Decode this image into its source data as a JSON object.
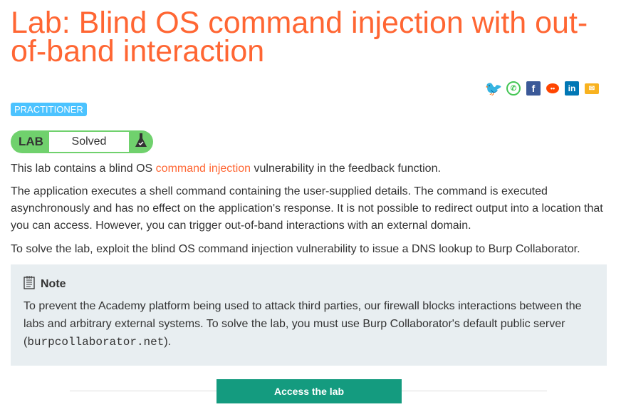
{
  "title": "Lab: Blind OS command injection with out-of-band interaction",
  "level": "PRACTITIONER",
  "lab_status": {
    "label": "LAB",
    "status": "Solved"
  },
  "intro": {
    "before": "This lab contains a blind OS ",
    "link": "command injection",
    "after": " vulnerability in the feedback function."
  },
  "para2": "The application executes a shell command containing the user-supplied details. The command is executed asynchronously and has no effect on the application's response. It is not possible to redirect output into a location that you can access. However, you can trigger out-of-band interactions with an external domain.",
  "para3": "To solve the lab, exploit the blind OS command injection vulnerability to issue a DNS lookup to Burp Collaborator.",
  "note": {
    "title": "Note",
    "text_before": "To prevent the Academy platform being used to attack third parties, our firewall blocks interactions between the labs and arbitrary external systems. To solve the lab, you must use Burp Collaborator's default public server (",
    "code": "burpcollaborator.net",
    "text_after": ")."
  },
  "access_button": "Access the lab",
  "colors": {
    "accent": "#ff6633",
    "badge": "#4cc3ff",
    "lab": "#70d16d",
    "button": "#149b7f"
  }
}
